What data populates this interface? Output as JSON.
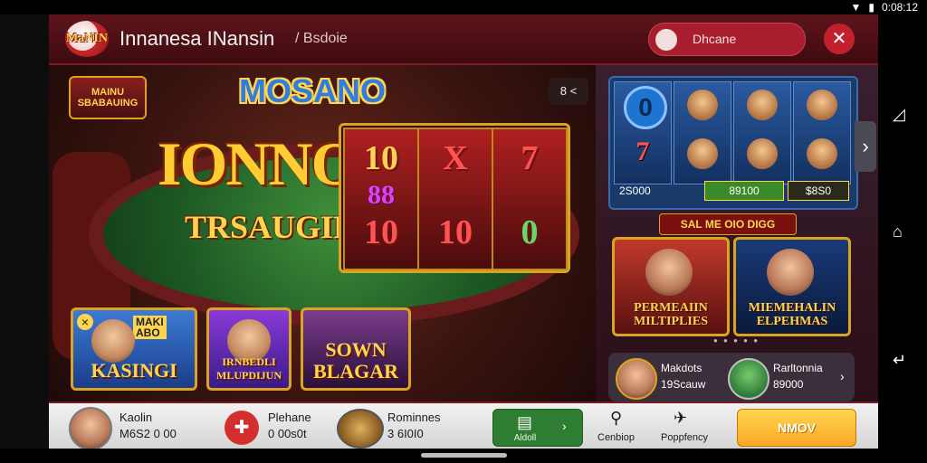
{
  "status_bar": {
    "time": "0:08:12"
  },
  "header": {
    "logo_text": "MaNIN",
    "title": "Innanesa  INansin",
    "subtitle": "/ Bsdoie",
    "pill_label": "Dhcane",
    "close_symbol": "✕"
  },
  "hero": {
    "badge_tl": "MAINU\nSBABAUING",
    "title": "MOSANO",
    "big_text": "IONNO",
    "sub_text": "TRSAUGINS",
    "nav_label": "8 <",
    "reels": [
      {
        "top": "10",
        "middle": "88",
        "bottom": "10"
      },
      {
        "top": "X",
        "middle": "",
        "bottom": "10"
      },
      {
        "top": "7",
        "middle": "",
        "bottom": "0"
      }
    ]
  },
  "game_cards": [
    {
      "label": "KASINGI",
      "top_label": "MAKI\nABO",
      "icon": "x-icon"
    },
    {
      "label": "IRNBEDLI\nMLUPDIJUN"
    },
    {
      "label": "SOWN\nBLAGAR"
    }
  ],
  "slots_panel": {
    "left_total": "2S000",
    "green_amount": "89100",
    "dark_amount": "$8S0",
    "left_sym": "7"
  },
  "promo": {
    "title": "SAL ME OIO DIGG",
    "cards": [
      {
        "label": "PERMEAIIN\nMILTIPLIES"
      },
      {
        "label": "MIEMEHALIN\nELPEHMAS"
      }
    ]
  },
  "user_row": {
    "name1": "Makdots",
    "val1": "19Scauw",
    "name2": "Rarltonnia",
    "val2": "89000",
    "chevron": "›"
  },
  "bottom_bar": {
    "user_name": "Kaolin",
    "user_amount": "M6S2 0 00",
    "plane_name": "Plehane",
    "plane_amount": "0 00s0t",
    "rom_name": "Rominnes",
    "rom_amount": "3 6I0I0",
    "green_label": "Aldoll",
    "chev": "›",
    "centrip_label": "Cenbiop",
    "poppfency_label": "Poppfency",
    "gold_button": "NMOV"
  }
}
